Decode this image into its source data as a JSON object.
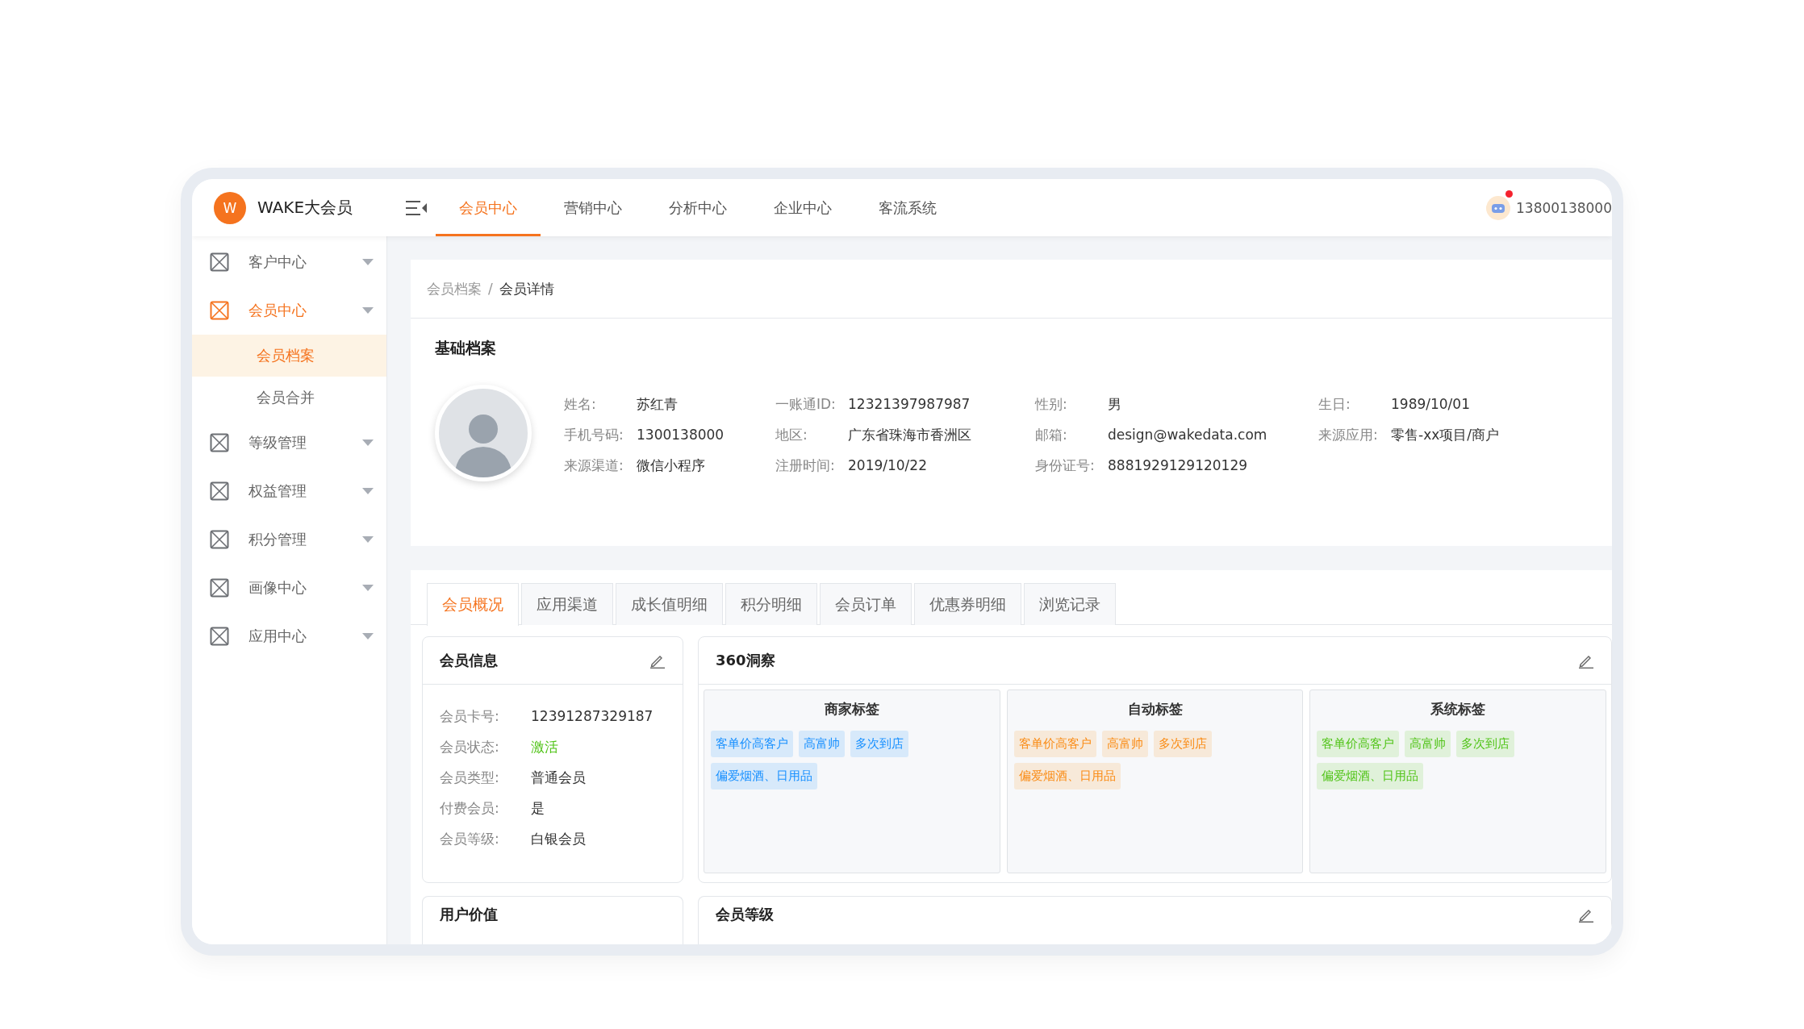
{
  "header": {
    "logo_letter": "W",
    "app_name": "WAKE大会员",
    "nav": [
      {
        "label": "会员中心",
        "selected": true
      },
      {
        "label": "营销中心",
        "selected": false
      },
      {
        "label": "分析中心",
        "selected": false
      },
      {
        "label": "企业中心",
        "selected": false
      },
      {
        "label": "客流系统",
        "selected": false
      }
    ],
    "user": {
      "phone": "13800138000",
      "notification": true
    }
  },
  "sidebar": {
    "items": [
      {
        "label": "客户中心",
        "selected": false
      },
      {
        "label": "会员中心",
        "selected": true,
        "children": [
          {
            "label": "会员档案",
            "selected": true
          },
          {
            "label": "会员合并",
            "selected": false
          }
        ]
      },
      {
        "label": "等级管理",
        "selected": false
      },
      {
        "label": "权益管理",
        "selected": false
      },
      {
        "label": "积分管理",
        "selected": false
      },
      {
        "label": "画像中心",
        "selected": false
      },
      {
        "label": "应用中心",
        "selected": false
      }
    ]
  },
  "breadcrumb": [
    "会员档案",
    "/",
    "会员详情"
  ],
  "profile": {
    "title": "基础档案",
    "fields": [
      {
        "label": "姓名:",
        "value": "苏红青"
      },
      {
        "label": "一账通ID:",
        "value": "12321397987987"
      },
      {
        "label": "性别:",
        "value": "男"
      },
      {
        "label": "生日:",
        "value": "1989/10/01"
      },
      {
        "label": "手机号码:",
        "value": "1300138000"
      },
      {
        "label": "地区:",
        "value": "广东省珠海市香洲区"
      },
      {
        "label": "邮箱:",
        "value": "design@wakedata.com"
      },
      {
        "label": "来源应用:",
        "value": "零售-xx项目/商户"
      },
      {
        "label": "来源渠道:",
        "value": "微信小程序"
      },
      {
        "label": "注册时间:",
        "value": "2019/10/22"
      },
      {
        "label": "身份证号:",
        "value": "8881929129120129"
      }
    ]
  },
  "tabs": [
    {
      "label": "会员概况",
      "selected": true
    },
    {
      "label": "应用渠道",
      "selected": false
    },
    {
      "label": "成长值明细",
      "selected": false
    },
    {
      "label": "积分明细",
      "selected": false
    },
    {
      "label": "会员订单",
      "selected": false
    },
    {
      "label": "优惠券明细",
      "selected": false
    },
    {
      "label": "浏览记录",
      "selected": false
    }
  ],
  "member_info": {
    "title": "会员信息",
    "fields": [
      {
        "label": "会员卡号:",
        "value": "12391287329187"
      },
      {
        "label": "会员状态:",
        "value": "激活",
        "color": "#52c41a"
      },
      {
        "label": "会员类型:",
        "value": "普通会员"
      },
      {
        "label": "付费会员:",
        "value": "是"
      },
      {
        "label": "会员等级:",
        "value": "白银会员"
      }
    ]
  },
  "insight": {
    "title": "360洞察",
    "groups": [
      {
        "title": "商家标签",
        "color": "#1890ff",
        "tags": [
          "客单价高客户",
          "高富帅",
          "多次到店",
          "偏爱烟酒、日用品"
        ]
      },
      {
        "title": "自动标签",
        "color": "#fa8c16",
        "tags": [
          "客单价高客户",
          "高富帅",
          "多次到店",
          "偏爱烟酒、日用品"
        ]
      },
      {
        "title": "系统标签",
        "color": "#52c41a",
        "tags": [
          "客单价高客户",
          "高富帅",
          "多次到店",
          "偏爱烟酒、日用品"
        ]
      }
    ]
  },
  "bottom_cards": [
    {
      "title": "用户价值",
      "editable": false
    },
    {
      "title": "会员等级",
      "editable": true
    }
  ]
}
